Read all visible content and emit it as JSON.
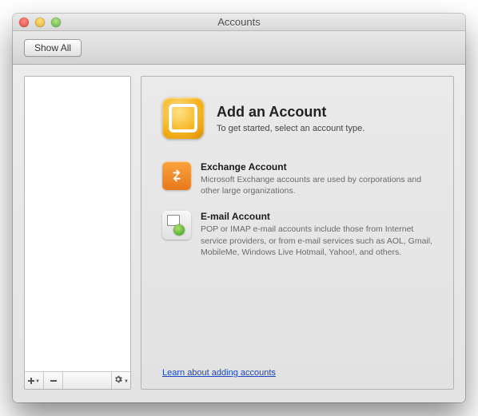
{
  "window": {
    "title": "Accounts"
  },
  "toolbar": {
    "show_all": "Show All"
  },
  "sidebar": {
    "items": [],
    "footer": {
      "add_icon": "plus-icon",
      "remove_icon": "minus-icon",
      "actions_icon": "gear-icon"
    }
  },
  "main": {
    "hero": {
      "icon": "outlook-icon",
      "title": "Add an Account",
      "subtitle": "To get started, select an account type."
    },
    "options": [
      {
        "key": "exchange",
        "icon": "exchange-icon",
        "title": "Exchange Account",
        "desc": "Microsoft Exchange accounts are used by corporations and other large organizations."
      },
      {
        "key": "email",
        "icon": "email-plus-icon",
        "title": "E-mail Account",
        "desc": "POP or IMAP e-mail accounts include those from Internet service providers, or from e-mail services such as AOL, Gmail, MobileMe, Windows Live Hotmail, Yahoo!, and others."
      }
    ],
    "learn_link": "Learn about adding accounts"
  }
}
